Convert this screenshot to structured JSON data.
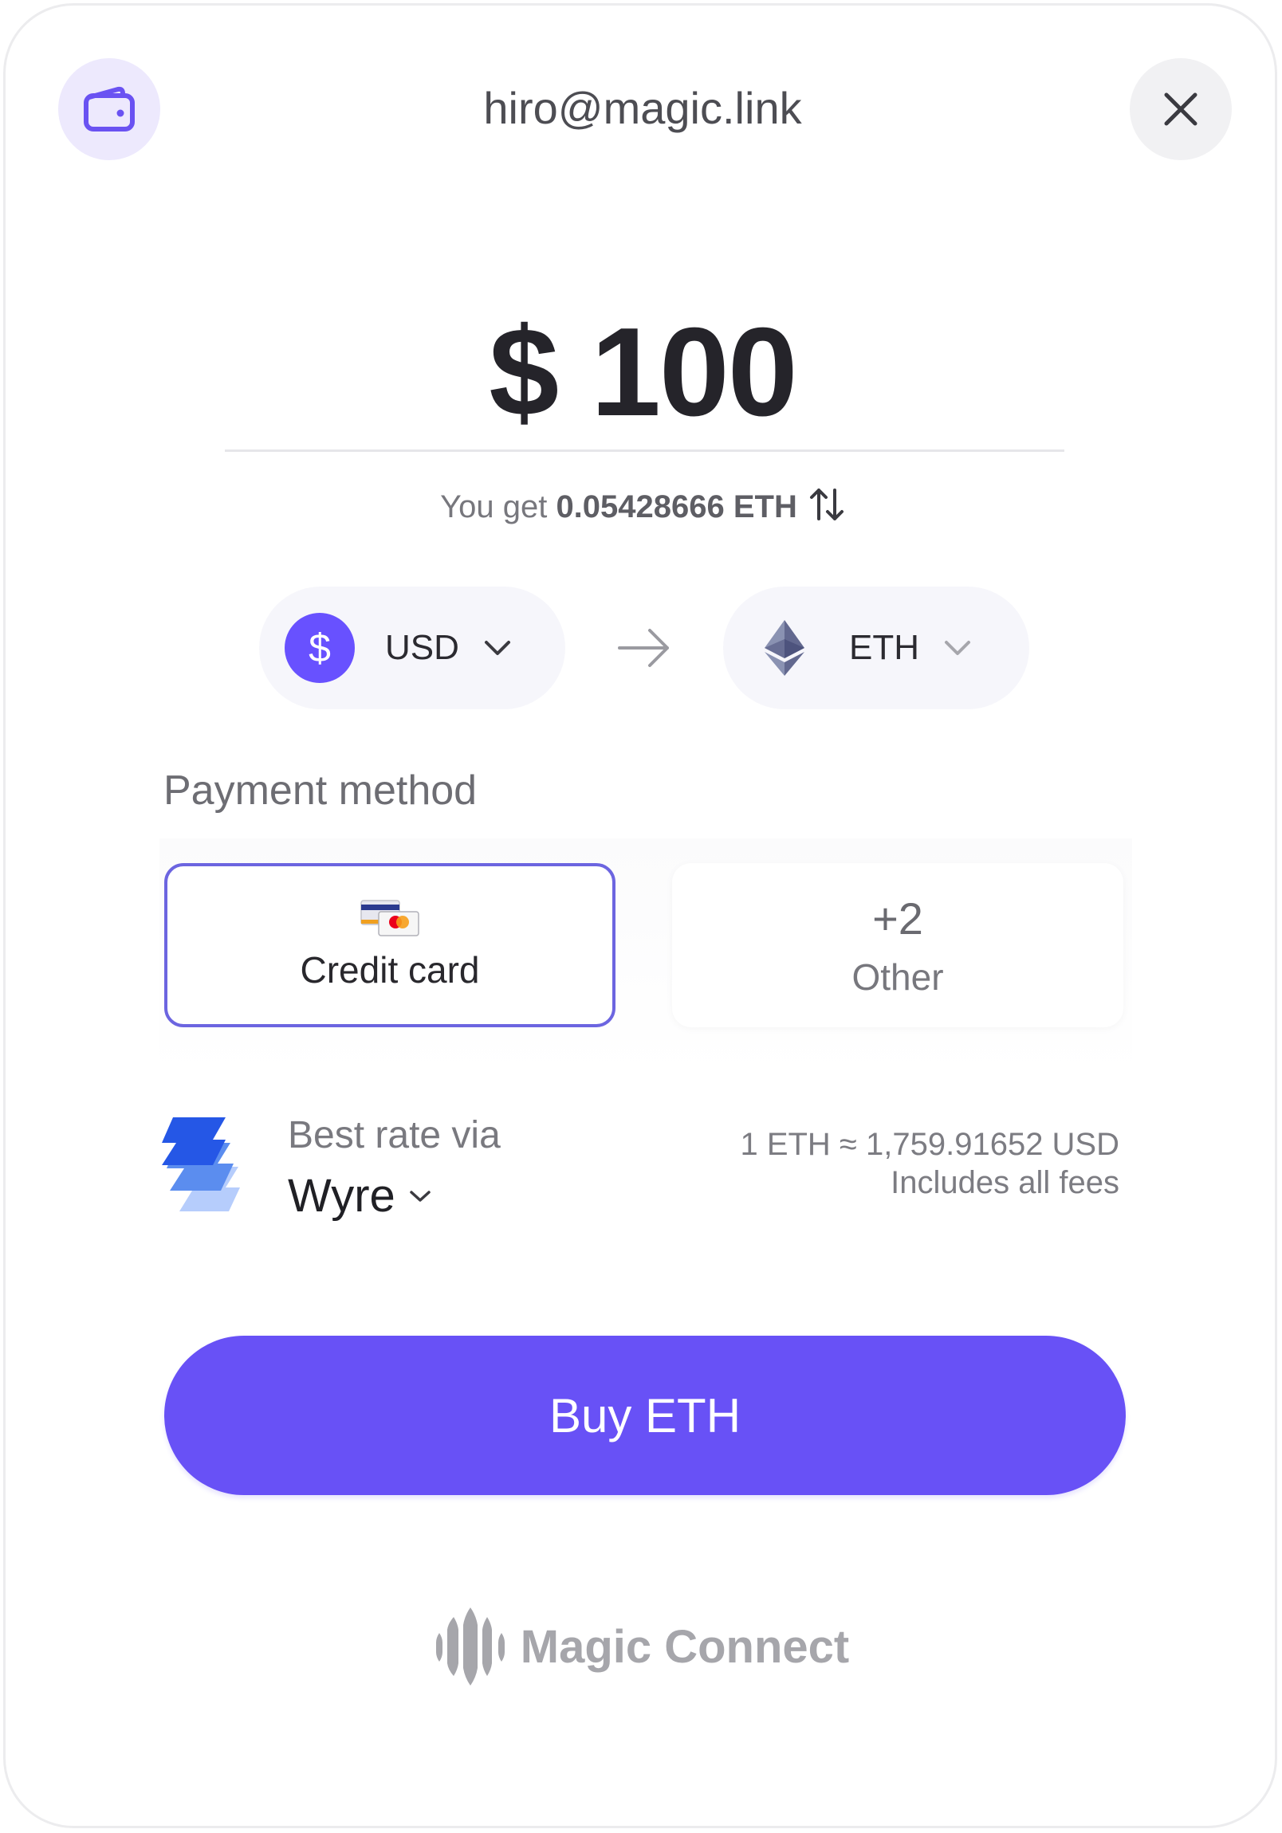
{
  "header": {
    "email": "hiro@magic.link",
    "wallet_icon": "wallet-icon",
    "close_icon": "close-icon"
  },
  "amount": {
    "value": "$ 100",
    "you_get_prefix": "You get",
    "you_get_value": "0.05428666 ETH"
  },
  "currency": {
    "from": {
      "label": "USD",
      "icon": "dollar-icon",
      "symbol": "$"
    },
    "to": {
      "label": "ETH",
      "icon": "ethereum-icon"
    }
  },
  "payment": {
    "label": "Payment method",
    "options": [
      {
        "title": "Credit card",
        "icon": "credit-card-icon",
        "selected": true
      },
      {
        "count": "+2",
        "title": "Other"
      }
    ]
  },
  "rate": {
    "best_rate_label": "Best rate via",
    "provider": "Wyre",
    "conversion": "1 ETH ≈ 1,759.91652 USD",
    "fees_note": "Includes all fees"
  },
  "buy_button": {
    "label": "Buy ETH"
  },
  "footer": {
    "brand": "Magic Connect"
  },
  "colors": {
    "accent": "#6851ff",
    "selected_border": "#6c65e0",
    "text_muted": "#77777d"
  }
}
